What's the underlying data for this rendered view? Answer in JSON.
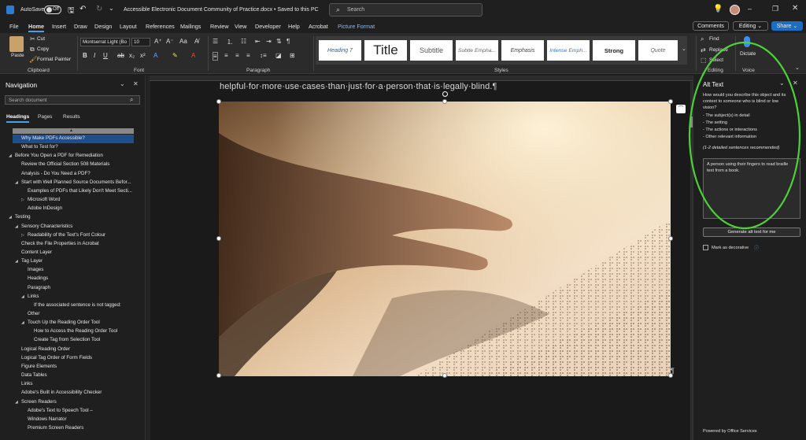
{
  "titlebar": {
    "autosave_label": "AutoSave",
    "autosave_state": "Off",
    "document_title": "Accessible Electronic Document Community of Practice.docx • Saved to this PC",
    "search_placeholder": "Search"
  },
  "menu": [
    "File",
    "Home",
    "Insert",
    "Draw",
    "Design",
    "Layout",
    "References",
    "Mailings",
    "Review",
    "View",
    "Developer",
    "Help",
    "Acrobat",
    "Picture Format"
  ],
  "menu_active": "Home",
  "header_buttons": {
    "comments": "Comments",
    "editing": "Editing",
    "share": "Share"
  },
  "ribbon": {
    "clipboard": {
      "paste": "Paste",
      "cut": "Cut",
      "copy": "Copy",
      "format_painter": "Format Painter",
      "label": "Clipboard"
    },
    "font": {
      "font_name": "Montserrat Light (Bo",
      "font_size": "10",
      "label": "Font"
    },
    "paragraph": {
      "label": "Paragraph"
    },
    "styles": {
      "items": [
        "Heading 7",
        "Title",
        "Subtitle",
        "Subtle Empha...",
        "Emphasis",
        "Intense Emph...",
        "Strong",
        "Quote"
      ],
      "label": "Styles"
    },
    "editing": {
      "find": "Find",
      "replace": "Replace",
      "select": "Select",
      "label": "Editing"
    },
    "voice": {
      "dictate": "Dictate",
      "label": "Voice"
    }
  },
  "navigation": {
    "title": "Navigation",
    "search_placeholder": "Search document",
    "tabs": [
      "Headings",
      "Pages",
      "Results"
    ],
    "active_tab": "Headings",
    "items": [
      {
        "text": "Why Make PDFs Accessible?",
        "level": 1,
        "selected": true
      },
      {
        "text": "What to Test for?",
        "level": 1
      },
      {
        "text": "Before You Open a PDF for Remediation",
        "level": 0,
        "expanded": true
      },
      {
        "text": "Review the Official Section 508 Materials",
        "level": 1
      },
      {
        "text": "Analysis - Do You Need a PDF?",
        "level": 1
      },
      {
        "text": "Start with Well Planned Source Documents Befor...",
        "level": 1,
        "expanded": true
      },
      {
        "text": "Examples of PDFs that Likely Don't Meet Secti...",
        "level": 2
      },
      {
        "text": "Microsoft Word",
        "level": 2,
        "expandable": true
      },
      {
        "text": "Adobe InDesign",
        "level": 2
      },
      {
        "text": "Testing",
        "level": 0,
        "expanded": true
      },
      {
        "text": "Sensory Characteristics",
        "level": 1,
        "expanded": true
      },
      {
        "text": "Readability of the Text's Font Colour",
        "level": 2,
        "expandable": true
      },
      {
        "text": "Check the File Properties in Acrobat",
        "level": 1
      },
      {
        "text": "Content Layer",
        "level": 1
      },
      {
        "text": "Tag Layer",
        "level": 1,
        "expanded": true
      },
      {
        "text": "Images",
        "level": 2
      },
      {
        "text": "Headings",
        "level": 2
      },
      {
        "text": "Paragraph",
        "level": 2
      },
      {
        "text": "Links",
        "level": 2,
        "expanded": true
      },
      {
        "text": "If the associated sentence is not tagged:",
        "level": 3
      },
      {
        "text": "Other",
        "level": 2
      },
      {
        "text": "Touch Up the Reading Order Tool",
        "level": 2,
        "expanded": true
      },
      {
        "text": "How to Access the Reading Order Tool",
        "level": 3
      },
      {
        "text": "Create Tag from Selection Tool",
        "level": 3
      },
      {
        "text": "Logical Reading Order",
        "level": 1
      },
      {
        "text": "Logical Tag Order of Form Fields",
        "level": 1
      },
      {
        "text": "Figure Elements",
        "level": 1
      },
      {
        "text": "Data Tables",
        "level": 1
      },
      {
        "text": "Links",
        "level": 1
      },
      {
        "text": "Adobe's Built in Accessibility Checker",
        "level": 1
      },
      {
        "text": "Screen Readers",
        "level": 1,
        "expanded": true
      },
      {
        "text": "Adobe's Text to Speech Tool –",
        "level": 2
      },
      {
        "text": "Windows Narrator",
        "level": 2
      },
      {
        "text": "Premium Screen Readers",
        "level": 2
      }
    ]
  },
  "document": {
    "body_text": "helpful·for·more·use·cases·than·just·for·a·person·that·is·legally·blind.¶",
    "pilcrow": "¶"
  },
  "alt_text_pane": {
    "title": "Alt Text",
    "intro": [
      "How would you describe this object and its",
      "context to someone who is blind or low",
      "vision?"
    ],
    "bullets": [
      "- The subject(s) in detail",
      "- The setting",
      "- The actions or interactions",
      "- Other relevant information"
    ],
    "recommendation": "(1-2 detailed sentences recommended)",
    "alt_value": [
      "A person using their fingers to read braille",
      "text from a book."
    ],
    "generate_button": "Generate alt text for me",
    "decorative_label": "Mark as decorative",
    "footer": "Powered by Office Services"
  },
  "colors": {
    "accent": "#4aa0e6",
    "share": "#1a6fc4",
    "selection": "#1e4e8c",
    "highlight_ring": "#4cd137"
  }
}
